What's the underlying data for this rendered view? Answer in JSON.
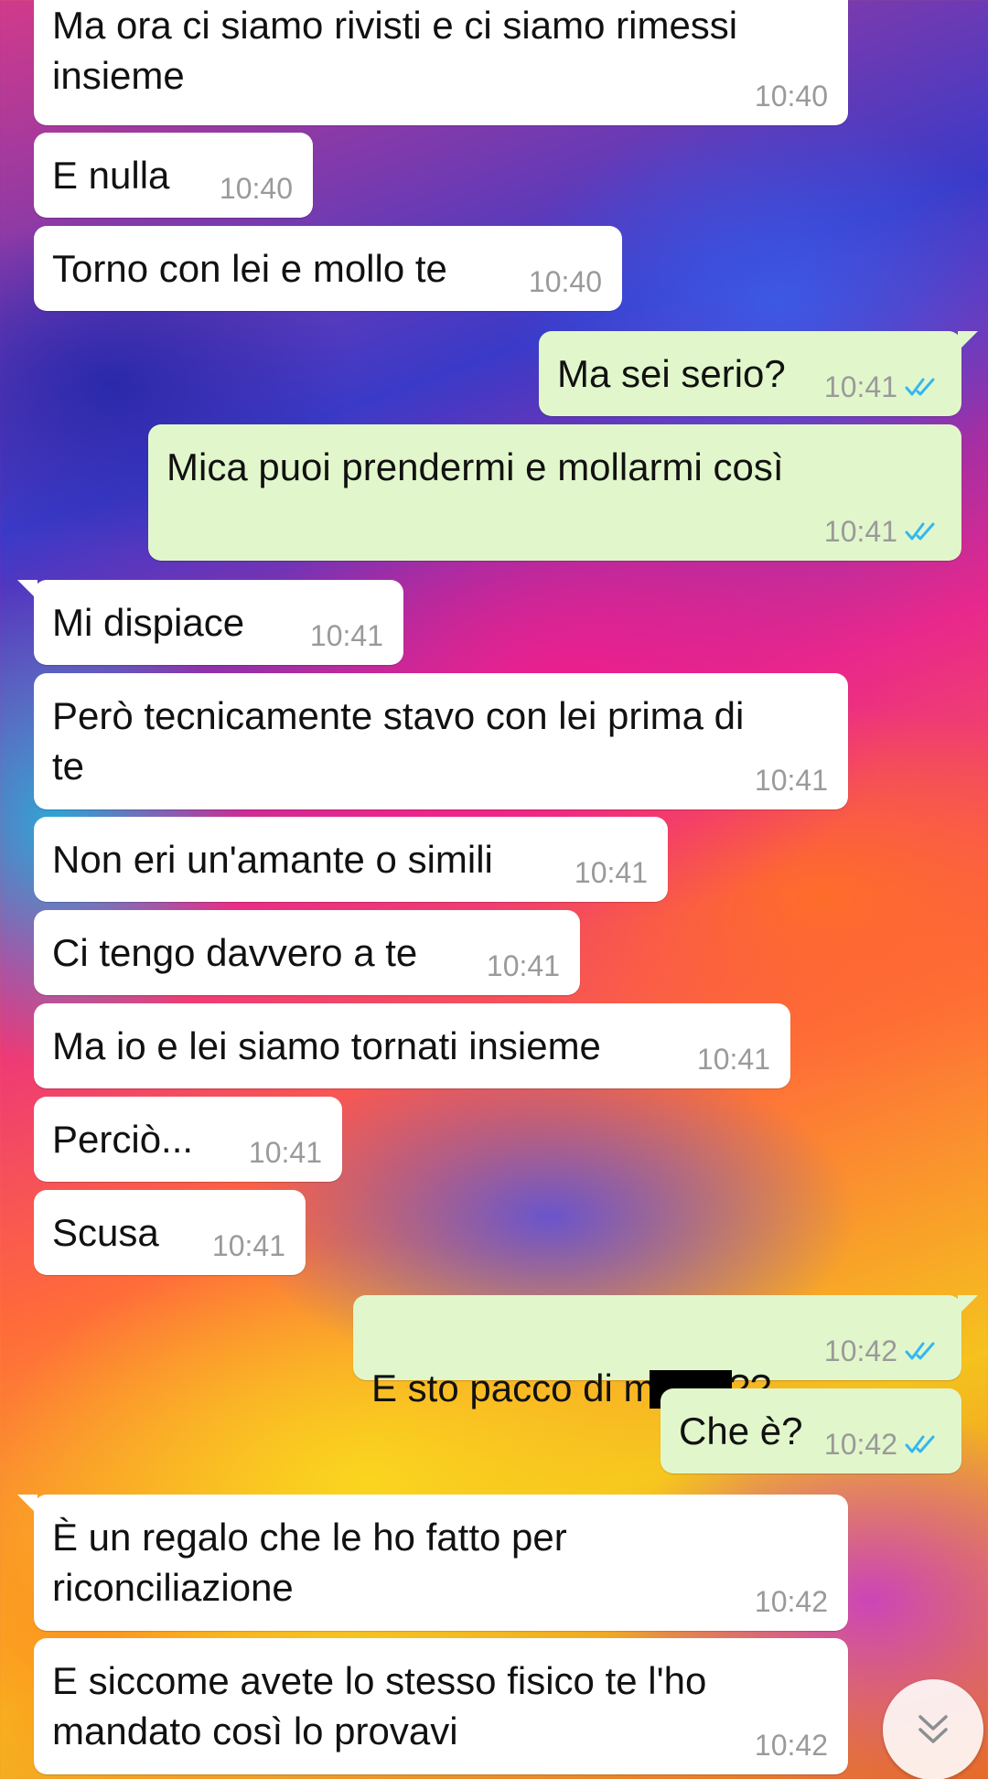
{
  "colors": {
    "incoming_bubble": "#ffffff",
    "outgoing_bubble": "#e1f7cb",
    "timestamp": "#9a9a9a",
    "read_ticks": "#34b7f1"
  },
  "messages": [
    {
      "direction": "incoming",
      "text": "Ma ora ci siamo rivisti e ci siamo rimessi\ninsieme",
      "time": "10:40"
    },
    {
      "direction": "incoming",
      "text": "E nulla",
      "time": "10:40"
    },
    {
      "direction": "incoming",
      "text": "Torno con lei e mollo te",
      "time": "10:40"
    },
    {
      "direction": "outgoing",
      "text": "Ma sei serio?",
      "time": "10:41",
      "status": "read"
    },
    {
      "direction": "outgoing",
      "text": "Mica puoi prendermi e mollarmi così",
      "time": "10:41",
      "status": "read"
    },
    {
      "direction": "incoming",
      "text": "Mi dispiace",
      "time": "10:41"
    },
    {
      "direction": "incoming",
      "text": "Però tecnicamente stavo con lei prima di\nte",
      "time": "10:41"
    },
    {
      "direction": "incoming",
      "text": "Non eri un'amante o simili",
      "time": "10:41"
    },
    {
      "direction": "incoming",
      "text": "Ci tengo davvero a te",
      "time": "10:41"
    },
    {
      "direction": "incoming",
      "text": "Ma io e lei siamo tornati insieme",
      "time": "10:41"
    },
    {
      "direction": "incoming",
      "text": "Perciò...",
      "time": "10:41"
    },
    {
      "direction": "incoming",
      "text": "Scusa",
      "time": "10:41"
    },
    {
      "direction": "outgoing",
      "text_before": "E sto pacco di m",
      "text_after": "??",
      "redacted": true,
      "time": "10:42",
      "status": "read"
    },
    {
      "direction": "outgoing",
      "text": "Che è?",
      "time": "10:42",
      "status": "read"
    },
    {
      "direction": "incoming",
      "text": "È un regalo che le ho fatto per\nriconciliazione",
      "time": "10:42"
    },
    {
      "direction": "incoming",
      "text": "E siccome avete lo stesso fisico te l'ho\nmandato così lo provavi",
      "time": "10:42"
    }
  ],
  "scroll_button": {
    "icon": "double-chevron-down-icon"
  }
}
